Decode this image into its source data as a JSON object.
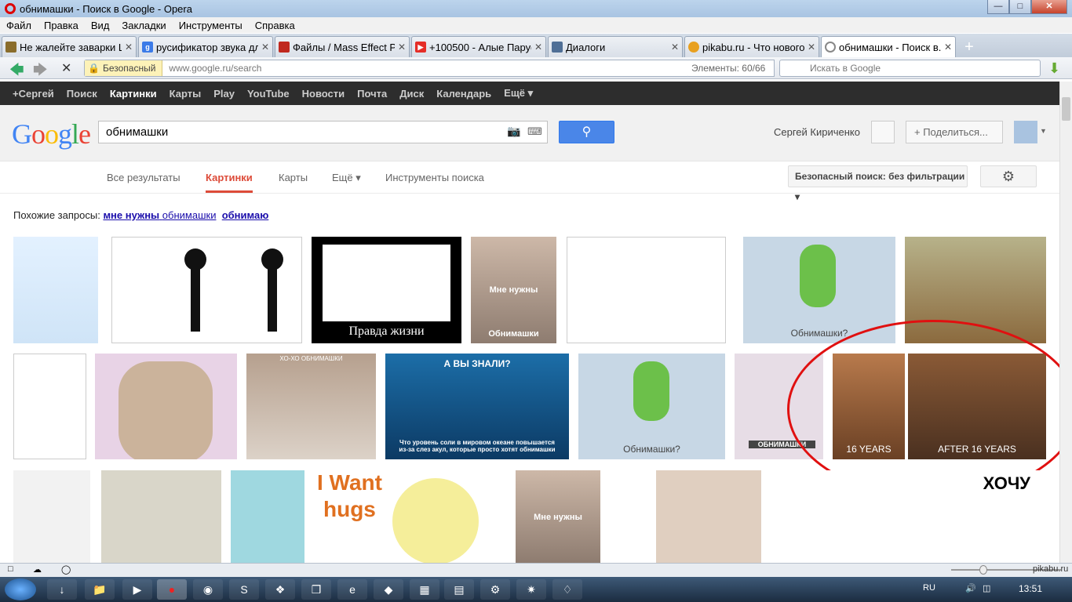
{
  "window": {
    "title": "обнимашки - Поиск в Google - Opera"
  },
  "menu": [
    "Файл",
    "Правка",
    "Вид",
    "Закладки",
    "Инструменты",
    "Справка"
  ],
  "tabs": [
    {
      "label": "Не жалейте заварки Li...",
      "color": "#8a6d2c",
      "icon": "lib-icon"
    },
    {
      "label": "русификатор звука дл...",
      "color": "#3b7be8",
      "icon": "google-icon"
    },
    {
      "label": "Файлы / Mass Effect P...",
      "color": "#c0281e",
      "icon": "pdf-icon"
    },
    {
      "label": "+100500 - Алые Парус...",
      "color": "#e52d27",
      "icon": "youtube-icon"
    },
    {
      "label": "Диалоги",
      "color": "#4f6f96",
      "icon": "vk-icon"
    },
    {
      "label": "pikabu.ru - Что нового",
      "color": "#e8a020",
      "icon": "pikabu-icon"
    },
    {
      "label": "обнимашки - Поиск в...",
      "color": "#888888",
      "icon": "loading-icon"
    }
  ],
  "address": {
    "secure_label": "Безопасный",
    "url_host": "www.google.ru",
    "url_path": "/search",
    "elements_label": "Элементы:",
    "elements_count": "60/66",
    "search_placeholder": "Искать в Google"
  },
  "gbar": [
    "+Сергей",
    "Поиск",
    "Картинки",
    "Карты",
    "Play",
    "YouTube",
    "Новости",
    "Почта",
    "Диск",
    "Календарь",
    "Ещё ▾"
  ],
  "search": {
    "query": "обнимашки",
    "user_name": "Сергей Кириченко",
    "share_label": "+ Поделиться..."
  },
  "subnav": {
    "all": "Все результаты",
    "images": "Картинки",
    "maps": "Карты",
    "more": "Ещё ▾",
    "tools": "Инструменты поиска",
    "safe_search": "Безопасный поиск: без фильтрации ▾"
  },
  "related": {
    "prefix": "Похожие запросы:",
    "link1_bold": "мне нужны",
    "link1_rest": "обнимашки",
    "link2": "обнимаю"
  },
  "thumb_captions": {
    "pravda": "Правда жизни",
    "mne_nuzhny": "Мне нужны",
    "obnimashki": "Обнимашки",
    "cactus": "Обнимашки?",
    "a_vy_znali": "А ВЫ ЗНАЛИ?",
    "shark_text": "Что уровень соли в мировом океане повышается из-за слез акул, которые просто хотят обнимашки",
    "years16": "16 YEARS",
    "after16": "AFTER 16 YEARS",
    "i_want": "I Want",
    "hugs": "hugs",
    "obnimashki_caps": "ОБНИМАШКИ",
    "hochu": "ХОЧУ",
    "xo_obnimashki": "ХО-ХО ОБНИМАШКИ",
    "mne_nuzhny2": "Мне нужны"
  },
  "status": {
    "lang": "RU",
    "time": "13:51",
    "watermark": "pikabu.ru"
  },
  "colors": {
    "google_blue": "#4285f4",
    "accent_red": "#dd4b39",
    "circle_red": "#e01010"
  }
}
